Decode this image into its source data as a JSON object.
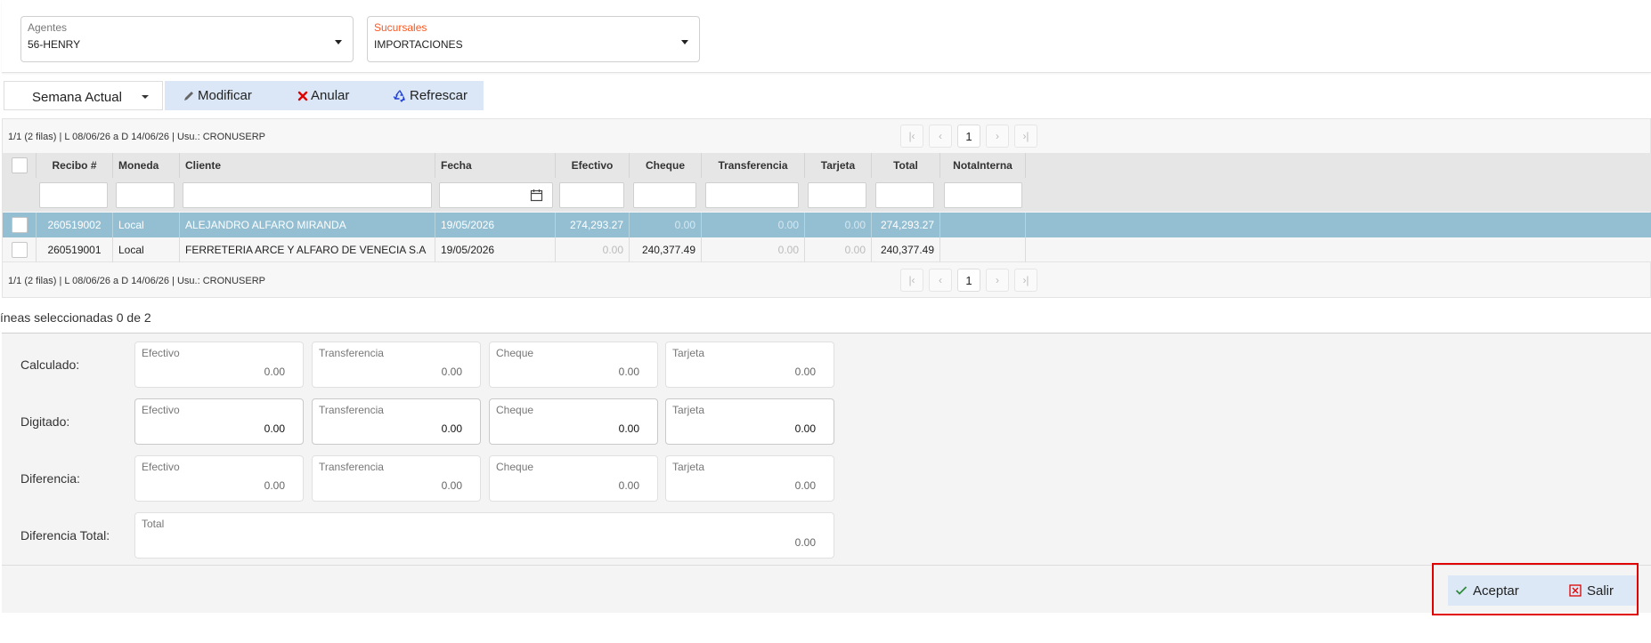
{
  "filters": {
    "agentes": {
      "label": "Agentes",
      "value": "56-HENRY"
    },
    "sucursales": {
      "label": "Sucursales",
      "value": "IMPORTACIONES",
      "label_color": "#ff5722"
    }
  },
  "toolbar": {
    "week_select": "Semana Actual",
    "modificar": "Modificar",
    "anular": "Anular",
    "refrescar": "Refrescar"
  },
  "pager": {
    "info": "1/1 (2 filas) | L 08/06/26 a D 14/06/26 | Usu.: CRONUSERP",
    "current_page": "1"
  },
  "grid": {
    "columns": [
      "Recibo #",
      "Moneda",
      "Cliente",
      "Fecha",
      "Efectivo",
      "Cheque",
      "Transferencia",
      "Tarjeta",
      "Total",
      "NotaInterna"
    ],
    "rows": [
      {
        "recibo": "260519002",
        "moneda": "Local",
        "cliente": "ALEJANDRO ALFARO MIRANDA",
        "fecha": "19/05/2026",
        "efectivo": "274,293.27",
        "cheque": "0.00",
        "transferencia": "0.00",
        "tarjeta": "0.00",
        "total": "274,293.27",
        "nota": "",
        "selected": true
      },
      {
        "recibo": "260519001",
        "moneda": "Local",
        "cliente": "FERRETERIA ARCE Y ALFARO DE VENECIA S.A",
        "fecha": "19/05/2026",
        "efectivo": "0.00",
        "cheque": "240,377.49",
        "transferencia": "0.00",
        "tarjeta": "0.00",
        "total": "240,377.49",
        "nota": "",
        "selected": false
      }
    ]
  },
  "selection": {
    "text": "íneas seleccionadas 0 de 2"
  },
  "summary": {
    "calculado": {
      "label": "Calculado:",
      "efectivo": "0.00",
      "transferencia": "0.00",
      "cheque": "0.00",
      "tarjeta": "0.00"
    },
    "digitado": {
      "label": "Digitado:",
      "efectivo": "0.00",
      "transferencia": "0.00",
      "cheque": "0.00",
      "tarjeta": "0.00"
    },
    "diferencia": {
      "label": "Diferencia:",
      "efectivo": "0.00",
      "transferencia": "0.00",
      "cheque": "0.00",
      "tarjeta": "0.00"
    },
    "field_labels": {
      "efectivo": "Efectivo",
      "transferencia": "Transferencia",
      "cheque": "Cheque",
      "tarjeta": "Tarjeta",
      "total": "Total"
    },
    "diferencia_total": {
      "label": "Diferencia Total:",
      "total": "0.00"
    }
  },
  "actions": {
    "aceptar": "Aceptar",
    "salir": "Salir"
  },
  "colors": {
    "selected_row": "#94bfd3",
    "toolbar_bg": "#dbe7f6",
    "highlight_border": "#e00000",
    "accept_check": "#2e8b3a",
    "cancel_red": "#e00000"
  },
  "icons": {
    "modificar": "pencil-icon",
    "anular": "x-icon",
    "refrescar": "recycle-icon",
    "fecha_filter": "calendar-icon",
    "aceptar": "check-icon",
    "salir": "close-box-icon"
  }
}
